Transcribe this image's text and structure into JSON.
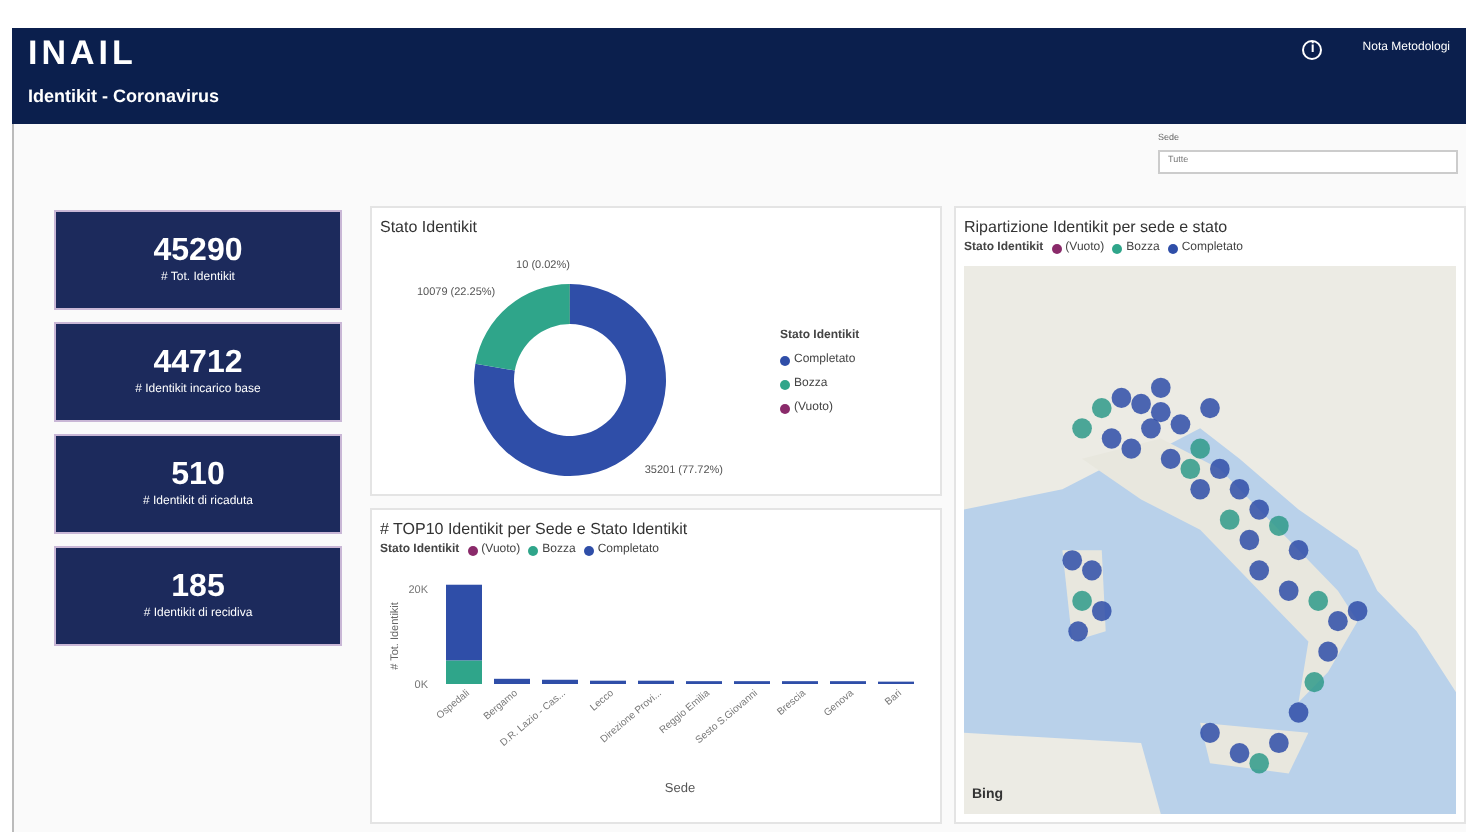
{
  "header": {
    "logo": "INAIL",
    "title": "Identikit - Coronavirus",
    "info_icon": "i",
    "link": "Nota Metodologi"
  },
  "filter": {
    "label": "Sede",
    "value": "Tutte"
  },
  "kpis": [
    {
      "value": "45290",
      "label": "# Tot. Identikit"
    },
    {
      "value": "44712",
      "label": "# Identikit incarico base"
    },
    {
      "value": "510",
      "label": "# Identikit di ricaduta"
    },
    {
      "value": "185",
      "label": "# Identikit di recidiva"
    }
  ],
  "donut": {
    "title": "Stato Identikit",
    "legend_title": "Stato Identikit",
    "chart_data": {
      "type": "donut",
      "categories": [
        "Completato",
        "Bozza",
        "(Vuoto)"
      ],
      "values": [
        35201,
        10079,
        10
      ],
      "colors": [
        "#2f4ea8",
        "#2fa58a",
        "#8a2a6a"
      ],
      "value_labels": [
        "35201 (77.72%)",
        "10079 (22.25%)",
        "10 (0.02%)"
      ]
    }
  },
  "bars": {
    "title": "# TOP10 Identikit per Sede e Stato Identikit",
    "legend_title": "Stato Identikit",
    "chart_data": {
      "type": "bar",
      "stacked": true,
      "xlabel": "Sede",
      "ylabel": "# Tot. Identikit",
      "categories": [
        "Ospedali",
        "Bergamo",
        "D.R. Lazio - Cas...",
        "Lecco",
        "Direzione Provi...",
        "Reggio Emilia",
        "Sesto S.Giovanni",
        "Brescia",
        "Genova",
        "Bari"
      ],
      "ylim": [
        0,
        22000
      ],
      "yticks": [
        {
          "value": 0,
          "label": "0K"
        },
        {
          "value": 20000,
          "label": "20K"
        }
      ],
      "series": [
        {
          "name": "(Vuoto)",
          "color": "#8a2a6a",
          "values": [
            0,
            0,
            0,
            0,
            0,
            0,
            0,
            0,
            0,
            0
          ]
        },
        {
          "name": "Bozza",
          "color": "#2fa58a",
          "values": [
            5000,
            null,
            null,
            null,
            null,
            null,
            null,
            null,
            null,
            null
          ]
        },
        {
          "name": "Completato",
          "color": "#2f4ea8",
          "values": [
            16000,
            1100,
            900,
            700,
            700,
            600,
            600,
            600,
            600,
            500
          ]
        }
      ]
    }
  },
  "map": {
    "title": "Ripartizione Identikit per sede e stato",
    "legend_title": "Stato Identikit",
    "legend": [
      {
        "label": "(Vuoto)",
        "color": "#8a2a6a"
      },
      {
        "label": "Bozza",
        "color": "#2fa58a"
      },
      {
        "label": "Completato",
        "color": "#2f4ea8"
      }
    ],
    "provider": "Bing"
  }
}
